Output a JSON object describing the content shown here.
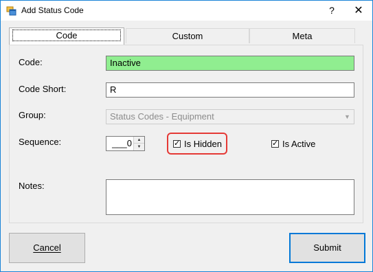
{
  "window": {
    "title": "Add Status Code",
    "help_glyph": "?",
    "close_glyph": "✕"
  },
  "tabs": [
    {
      "label": "Code",
      "active": true
    },
    {
      "label": "Custom",
      "active": false
    },
    {
      "label": "Meta",
      "active": false
    }
  ],
  "form": {
    "code_label": "Code:",
    "code_value": "Inactive",
    "code_short_label": "Code Short:",
    "code_short_value": "R",
    "group_label": "Group:",
    "group_value": "Status Codes - Equipment",
    "sequence_label": "Sequence:",
    "sequence_value": "___0",
    "is_hidden_label": "Is Hidden",
    "is_hidden_checked": true,
    "is_active_label": "Is Active",
    "is_active_checked": true,
    "notes_label": "Notes:",
    "notes_value": ""
  },
  "buttons": {
    "cancel_label": "Cancel",
    "submit_label": "Submit"
  },
  "colors": {
    "code_field_bg": "#90ee90",
    "highlight": "#e53935",
    "window_border": "#1883d7"
  },
  "icons": {
    "app": "app-window-icon",
    "help": "help-icon",
    "close": "close-icon",
    "dropdown": "chevron-down-icon",
    "spin_up": "spin-up-icon",
    "spin_down": "spin-down-icon"
  }
}
